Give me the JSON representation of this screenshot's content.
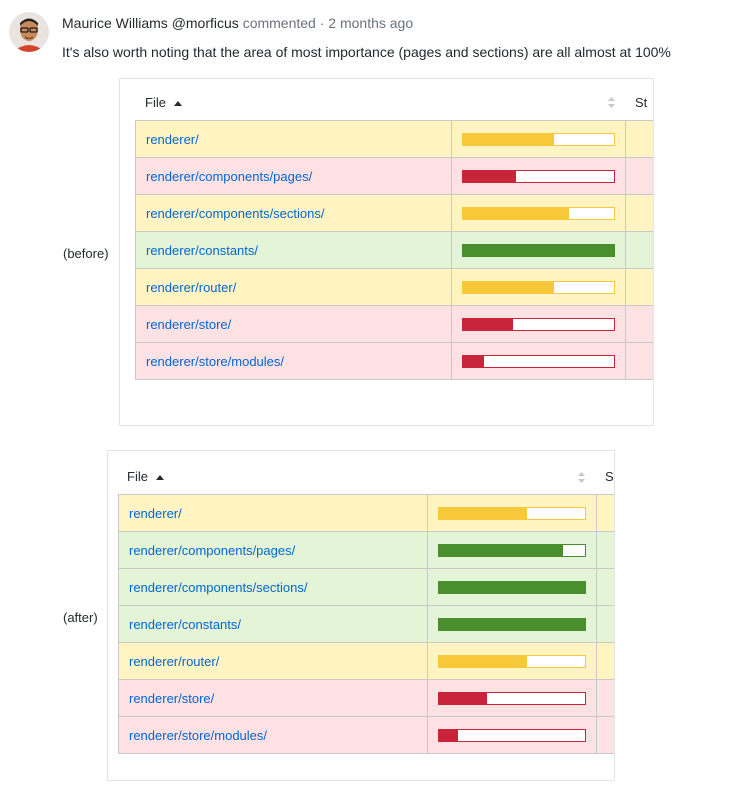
{
  "comment": {
    "author": "Maurice Williams",
    "handle": "@morficus",
    "action": "commented",
    "separator": "·",
    "time": "2 months ago",
    "text": "It's also worth noting that the area of most importance (pages and sections) are all almost at 100%"
  },
  "colors": {
    "high": "#4a8f2e",
    "medium": "#f7c83a",
    "low": "#c8243a"
  },
  "tables": [
    {
      "label": "(before)",
      "file_header": "File",
      "next_header": "St",
      "sort_icon": "sort-ascending-icon",
      "rows": [
        {
          "file": "renderer/",
          "level": "medium",
          "coverage": 0.6
        },
        {
          "file": "renderer/components/pages/",
          "level": "low",
          "coverage": 0.35
        },
        {
          "file": "renderer/components/sections/",
          "level": "medium",
          "coverage": 0.7
        },
        {
          "file": "renderer/constants/",
          "level": "high",
          "coverage": 1.0
        },
        {
          "file": "renderer/router/",
          "level": "medium",
          "coverage": 0.6
        },
        {
          "file": "renderer/store/",
          "level": "low",
          "coverage": 0.33
        },
        {
          "file": "renderer/store/modules/",
          "level": "low",
          "coverage": 0.14
        }
      ]
    },
    {
      "label": "(after)",
      "file_header": "File",
      "next_header": "S",
      "sort_icon": "sort-ascending-icon",
      "rows": [
        {
          "file": "renderer/",
          "level": "medium",
          "coverage": 0.6
        },
        {
          "file": "renderer/components/pages/",
          "level": "high",
          "coverage": 0.85
        },
        {
          "file": "renderer/components/sections/",
          "level": "high",
          "coverage": 1.0
        },
        {
          "file": "renderer/constants/",
          "level": "high",
          "coverage": 1.0
        },
        {
          "file": "renderer/router/",
          "level": "medium",
          "coverage": 0.6
        },
        {
          "file": "renderer/store/",
          "level": "low",
          "coverage": 0.33
        },
        {
          "file": "renderer/store/modules/",
          "level": "low",
          "coverage": 0.13
        }
      ]
    }
  ]
}
